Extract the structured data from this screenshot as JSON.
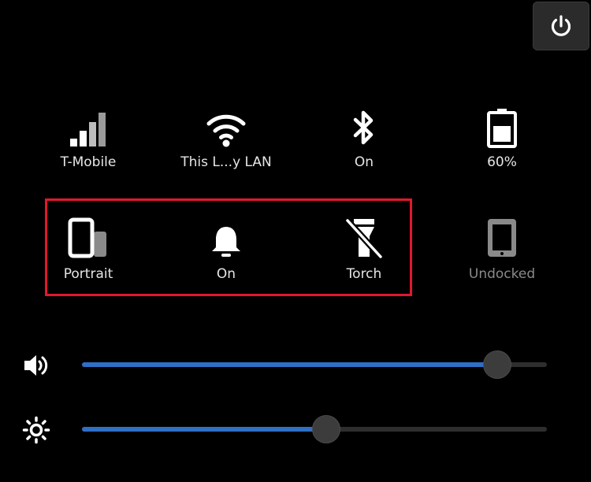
{
  "power": {
    "icon": "power-icon"
  },
  "tiles_row1": [
    {
      "label": "T-Mobile",
      "icon": "cellular-signal-icon"
    },
    {
      "label": "This L...y LAN",
      "icon": "wifi-icon"
    },
    {
      "label": "On",
      "icon": "bluetooth-icon"
    },
    {
      "label": "60%",
      "icon": "battery-icon"
    }
  ],
  "tiles_row2": [
    {
      "label": "Portrait",
      "icon": "rotation-portrait-icon"
    },
    {
      "label": "On",
      "icon": "bell-icon"
    },
    {
      "label": "Torch",
      "icon": "torch-off-icon"
    },
    {
      "label": "Undocked",
      "icon": "tablet-icon",
      "disabled": true
    }
  ],
  "sliders": {
    "volume": {
      "icon": "speaker-volume-icon",
      "value": 0.894
    },
    "brightness": {
      "icon": "brightness-icon",
      "value": 0.525
    }
  },
  "colors": {
    "background": "#000000",
    "accent": "#2f6fc6",
    "highlight": "#e3172f",
    "text": "#e6e6e6",
    "disabled_text": "#8a8a8a"
  }
}
